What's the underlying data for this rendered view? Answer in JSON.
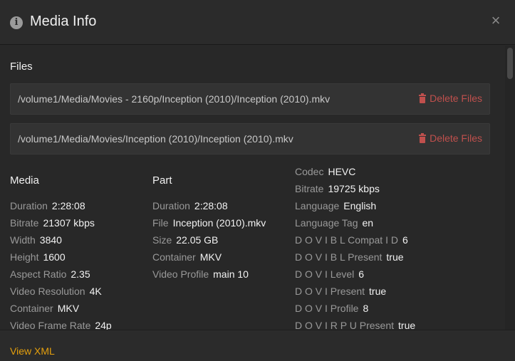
{
  "header": {
    "title": "Media Info",
    "close_glyph": "×",
    "info_glyph": "i",
    "info_icon": "info-icon",
    "close_icon": "close-icon"
  },
  "files": {
    "heading": "Files",
    "items": [
      {
        "path": "/volume1/Media/Movies - 2160p/Inception (2010)/Inception (2010).mkv",
        "delete_label": "Delete Files"
      },
      {
        "path": "/volume1/Media/Movies/Inception (2010)/Inception (2010).mkv",
        "delete_label": "Delete Files"
      }
    ],
    "delete_color": "#c0504d"
  },
  "media": {
    "heading": "Media",
    "rows": [
      {
        "label": "Duration",
        "value": "2:28:08"
      },
      {
        "label": "Bitrate",
        "value": "21307 kbps"
      },
      {
        "label": "Width",
        "value": "3840"
      },
      {
        "label": "Height",
        "value": "1600"
      },
      {
        "label": "Aspect Ratio",
        "value": "2.35"
      },
      {
        "label": "Video Resolution",
        "value": "4K"
      },
      {
        "label": "Container",
        "value": "MKV"
      },
      {
        "label": "Video Frame Rate",
        "value": "24p"
      }
    ]
  },
  "part": {
    "heading": "Part",
    "rows": [
      {
        "label": "Duration",
        "value": "2:28:08"
      },
      {
        "label": "File",
        "value": "Inception (2010).mkv"
      },
      {
        "label": "Size",
        "value": "22.05 GB"
      },
      {
        "label": "Container",
        "value": "MKV"
      },
      {
        "label": "Video Profile",
        "value": "main 10"
      }
    ]
  },
  "stream": {
    "rows": [
      {
        "label": "Codec",
        "value": "HEVC"
      },
      {
        "label": "Bitrate",
        "value": "19725 kbps"
      },
      {
        "label": "Language",
        "value": "English"
      },
      {
        "label": "Language Tag",
        "value": "en"
      },
      {
        "label": "D O V I B L Compat I D",
        "value": "6"
      },
      {
        "label": "D O V I B L Present",
        "value": "true"
      },
      {
        "label": "D O V I Level",
        "value": "6"
      },
      {
        "label": "D O V I Present",
        "value": "true"
      },
      {
        "label": "D O V I Profile",
        "value": "8"
      },
      {
        "label": "D O V I R P U Present",
        "value": "true"
      }
    ]
  },
  "footer": {
    "view_xml_label": "View XML",
    "accent_color": "#e5a00d"
  }
}
